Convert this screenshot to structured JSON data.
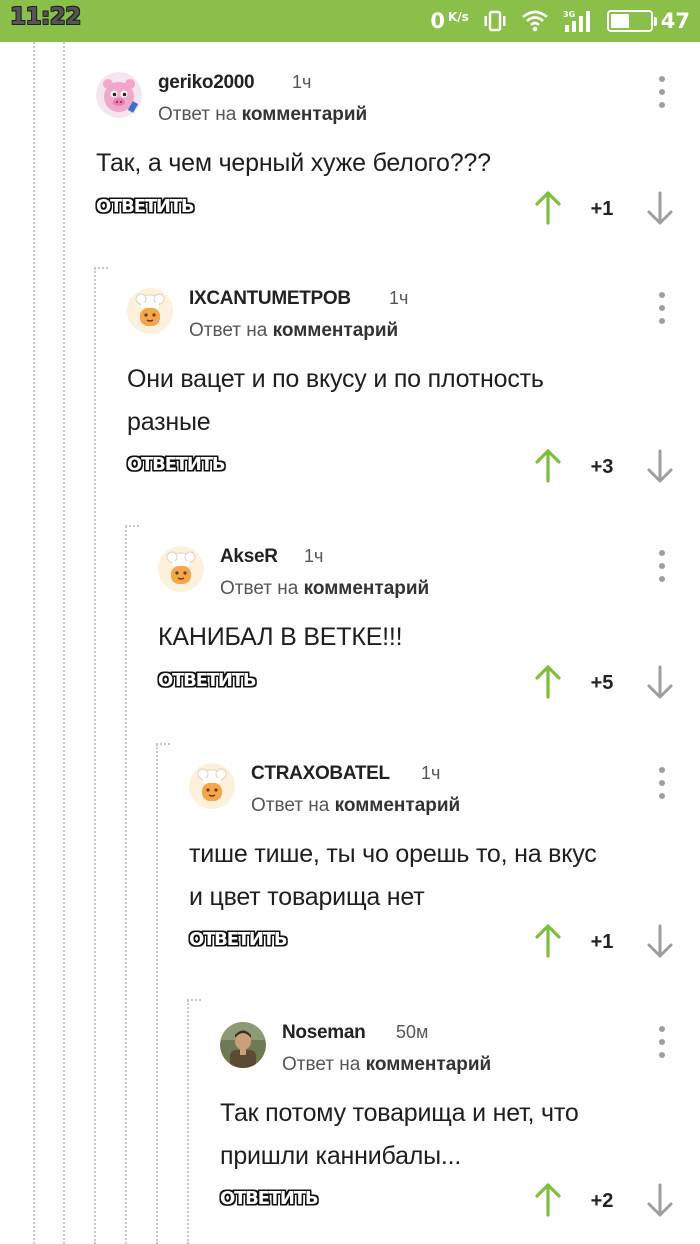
{
  "status_bar": {
    "time": "11:22",
    "net_speed": "0",
    "net_unit": "K/s",
    "battery_level": "47"
  },
  "comments": [
    {
      "author": "geriko2000",
      "time": "1ч",
      "reply_prefix": "Ответ на",
      "reply_target": "комментарий",
      "text_lines": [
        "Так, а чем черный хуже белого???"
      ],
      "reply_label": "ОТВЕТИТЬ",
      "rating": "+1",
      "avatar_icon": "pink-hedgehog-avatar"
    },
    {
      "author": "IXCANTUMETPOB",
      "time": "1ч",
      "reply_prefix": "Ответ на",
      "reply_target": "комментарий",
      "text_lines": [
        "Они вацет и по вкусу и по плотность",
        "разные"
      ],
      "reply_label": "ОТВЕТИТЬ",
      "rating": "+3",
      "avatar_icon": "chef-avatar"
    },
    {
      "author": "AkseR",
      "time": "1ч",
      "reply_prefix": "Ответ на",
      "reply_target": "комментарий",
      "text_lines": [
        "КАНИБАЛ В ВЕТКЕ!!!"
      ],
      "reply_label": "ОТВЕТИТЬ",
      "rating": "+5",
      "avatar_icon": "chef-avatar"
    },
    {
      "author": "CTRAXOBATEL",
      "time": "1ч",
      "reply_prefix": "Ответ на",
      "reply_target": "комментарий",
      "text_lines": [
        "тише тише, ты чо орешь то, на вкус",
        "и цвет товарища нет"
      ],
      "reply_label": "ОТВЕТИТЬ",
      "rating": "+1",
      "avatar_icon": "chef-avatar"
    },
    {
      "author": "Noseman",
      "time": "50м",
      "reply_prefix": "Ответ на",
      "reply_target": "комментарий",
      "text_lines": [
        "Так потому товарища и нет, что",
        "пришли каннибалы..."
      ],
      "reply_label": "ОТВЕТИТЬ",
      "rating": "+2",
      "avatar_icon": "photo-avatar"
    }
  ],
  "colors": {
    "status_bar": "#8ac04a",
    "upvote": "#7bbf3c",
    "downvote": "#9e9e9e"
  }
}
